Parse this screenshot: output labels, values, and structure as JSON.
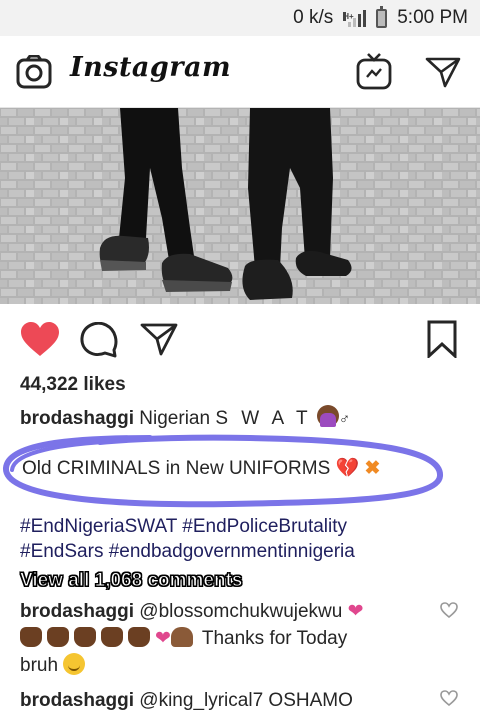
{
  "status_bar": {
    "speed": "0 k/s",
    "network": "H+",
    "time": "5:00 PM"
  },
  "app": {
    "name": "Instagram",
    "icons": [
      "camera-icon",
      "igtv-icon",
      "direct-message-icon"
    ]
  },
  "post": {
    "actions": [
      "heart-icon-liked",
      "comment-icon",
      "share-icon",
      "bookmark-icon"
    ],
    "likes": "44,322 likes",
    "caption": {
      "username": "brodashaggi",
      "text": "Nigerian",
      "spaced_text": "S W A T",
      "emoji": "woman-facepalming",
      "symbol": "♂"
    },
    "highlighted_line": {
      "text": "Old CRIMINALS in New UNIFORMS",
      "emoji_1": "💔",
      "emoji_2": "✖"
    },
    "hashtags": [
      "#EndNigeriaSWAT #EndPoliceBrutality",
      "#EndSars #endbadgovernmentinnigeria"
    ],
    "view_all": "View all 1,068 comments"
  },
  "comments": [
    {
      "username": "brodashaggi",
      "mention": "@blossomchukwujekwu",
      "emoji_after_mention": "❤",
      "line2_text": "Thanks for Today",
      "line3_text": "bruh"
    },
    {
      "username": "brodashaggi",
      "mention": "@king_lyrical7",
      "text": "OSHAMO"
    }
  ],
  "colors": {
    "liked_heart": "#ed4956",
    "highlight_ring": "#7b74e8",
    "text": "#262626"
  }
}
